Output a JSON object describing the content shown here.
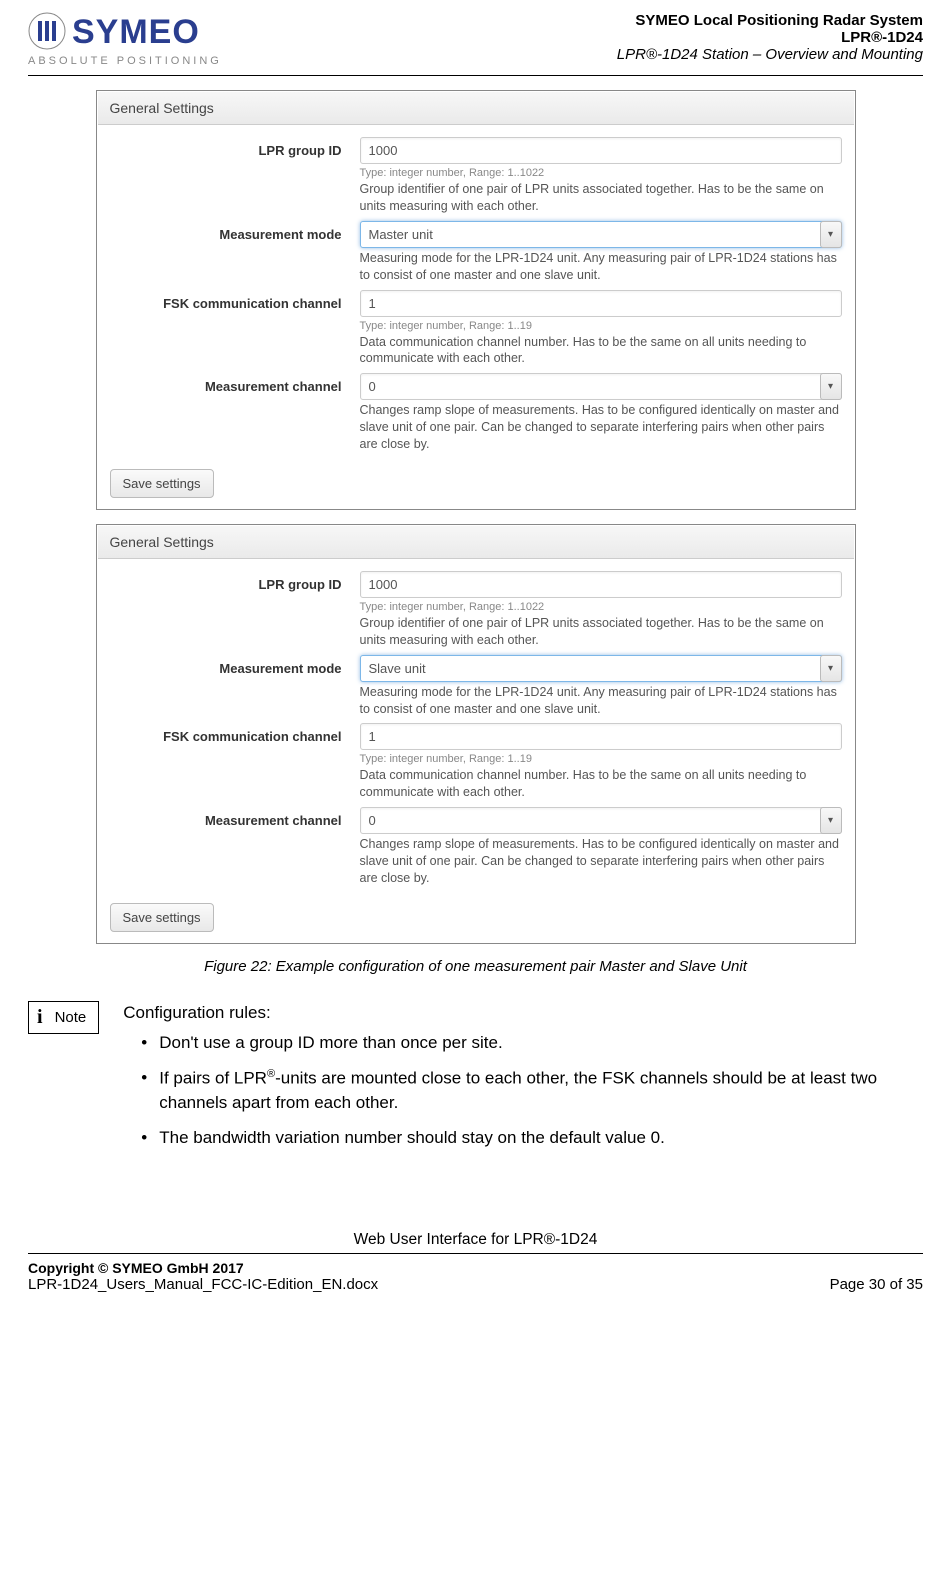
{
  "header": {
    "logo_word": "SYMEO",
    "logo_sub": "ABSOLUTE POSITIONING",
    "line1": "SYMEO Local Positioning Radar System",
    "line2": "LPR®-1D24",
    "line3": "LPR®-1D24 Station – Overview and Mounting"
  },
  "panels": [
    {
      "title": "General Settings",
      "fields": {
        "group_id": {
          "label": "LPR group ID",
          "value": "1000",
          "hint_small": "Type: integer number, Range: 1..1022",
          "hint": "Group identifier of one pair of LPR units associated together. Has to be the same on units measuring with each other."
        },
        "mode": {
          "label": "Measurement mode",
          "value": "Master unit",
          "hint": "Measuring mode for the LPR-1D24 unit. Any measuring pair of LPR-1D24 stations has to consist of one master and one slave unit."
        },
        "fsk": {
          "label": "FSK communication channel",
          "value": "1",
          "hint_small": "Type: integer number, Range: 1..19",
          "hint": "Data communication channel number. Has to be the same on all units needing to communicate with each other."
        },
        "mchan": {
          "label": "Measurement channel",
          "value": "0",
          "hint": "Changes ramp slope of measurements. Has to be configured identically on master and slave unit of one pair. Can be changed to separate interfering pairs when other pairs are close by."
        }
      },
      "save": "Save settings"
    },
    {
      "title": "General Settings",
      "fields": {
        "group_id": {
          "label": "LPR group ID",
          "value": "1000",
          "hint_small": "Type: integer number, Range: 1..1022",
          "hint": "Group identifier of one pair of LPR units associated together. Has to be the same on units measuring with each other."
        },
        "mode": {
          "label": "Measurement mode",
          "value": "Slave unit",
          "hint": "Measuring mode for the LPR-1D24 unit. Any measuring pair of LPR-1D24 stations has to consist of one master and one slave unit."
        },
        "fsk": {
          "label": "FSK communication channel",
          "value": "1",
          "hint_small": "Type: integer number, Range: 1..19",
          "hint": "Data communication channel number. Has to be the same on all units needing to communicate with each other."
        },
        "mchan": {
          "label": "Measurement channel",
          "value": "0",
          "hint": "Changes ramp slope of measurements. Has to be configured identically on master and slave unit of one pair. Can be changed to separate interfering pairs when other pairs are close by."
        }
      },
      "save": "Save settings"
    }
  ],
  "caption": "Figure 22: Example configuration of one measurement pair Master and Slave Unit",
  "note": {
    "badge": "Note",
    "title": "Configuration rules:",
    "bullets": [
      "Don't use a group ID more than once per site.",
      "If pairs of LPR®-units are mounted close to each other, the FSK channels should be at least two channels apart from each other.",
      "The bandwidth variation number should stay on the default value 0."
    ]
  },
  "footer": {
    "center": "Web User Interface for LPR®-1D24",
    "copyright": "Copyright © SYMEO GmbH 2017",
    "filename": "LPR-1D24_Users_Manual_FCC-IC-Edition_EN.docx",
    "page": "Page 30 of 35"
  }
}
